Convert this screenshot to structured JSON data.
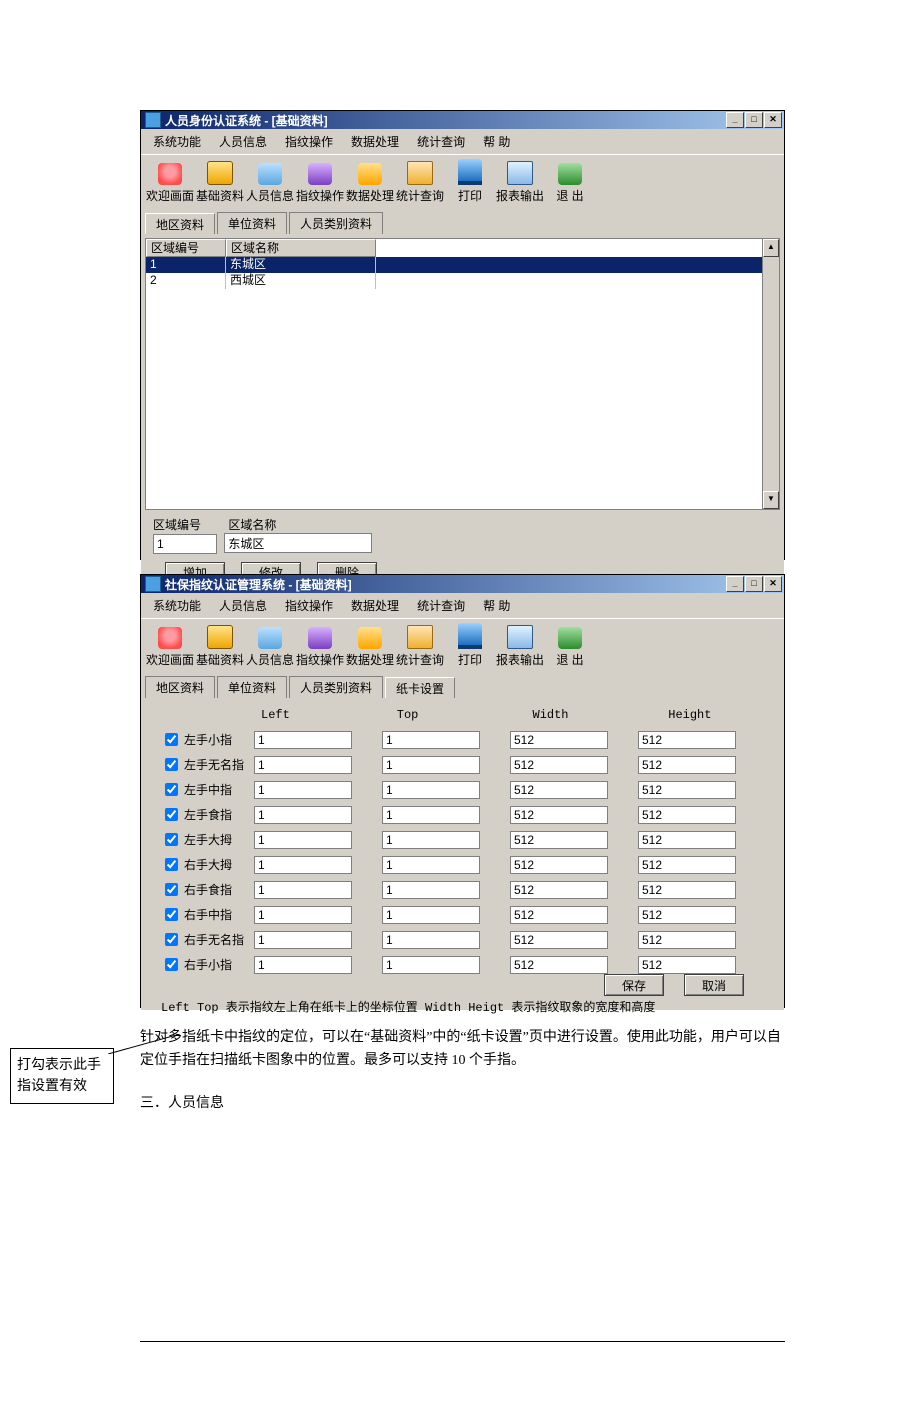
{
  "win1": {
    "title": "人员身份认证系统 - [基础资料]",
    "menu": [
      "系统功能",
      "人员信息",
      "指纹操作",
      "数据处理",
      "统计查询",
      "帮      助"
    ],
    "toolbar": [
      "欢迎画面",
      "基础资料",
      "人员信息",
      "指纹操作",
      "数据处理",
      "统计查询",
      "打印",
      "报表输出",
      "退  出"
    ],
    "tabs": [
      "地区资料",
      "单位资料",
      "人员类别资料"
    ],
    "grid": {
      "headers": [
        "区域编号",
        "区域名称"
      ],
      "rows": [
        {
          "id": "1",
          "name": "东城区"
        },
        {
          "id": "2",
          "name": "西城区"
        }
      ]
    },
    "edit": {
      "label_id": "区域编号",
      "label_name": "区域名称",
      "value_id": "1",
      "value_name": "东城区"
    },
    "buttons": {
      "add": "增加",
      "edit": "修改",
      "del": "删除"
    }
  },
  "win2": {
    "title": "社保指纹认证管理系统 - [基础资料]",
    "menu": [
      "系统功能",
      "人员信息",
      "指纹操作",
      "数据处理",
      "统计查询",
      "帮      助"
    ],
    "toolbar": [
      "欢迎画面",
      "基础资料",
      "人员信息",
      "指纹操作",
      "数据处理",
      "统计查询",
      "打印",
      "报表输出",
      "退  出"
    ],
    "tabs": [
      "地区资料",
      "单位资料",
      "人员类别资料",
      "纸卡设置"
    ],
    "colheads": [
      "Left",
      "Top",
      "Width",
      "Height"
    ],
    "fingers": [
      {
        "label": "左手小指",
        "left": "1",
        "top": "1",
        "width": "512",
        "height": "512"
      },
      {
        "label": "左手无名指",
        "left": "1",
        "top": "1",
        "width": "512",
        "height": "512"
      },
      {
        "label": "左手中指",
        "left": "1",
        "top": "1",
        "width": "512",
        "height": "512"
      },
      {
        "label": "左手食指",
        "left": "1",
        "top": "1",
        "width": "512",
        "height": "512"
      },
      {
        "label": "左手大拇",
        "left": "1",
        "top": "1",
        "width": "512",
        "height": "512"
      },
      {
        "label": "右手大拇",
        "left": "1",
        "top": "1",
        "width": "512",
        "height": "512"
      },
      {
        "label": "右手食指",
        "left": "1",
        "top": "1",
        "width": "512",
        "height": "512"
      },
      {
        "label": "右手中指",
        "left": "1",
        "top": "1",
        "width": "512",
        "height": "512"
      },
      {
        "label": "右手无名指",
        "left": "1",
        "top": "1",
        "width": "512",
        "height": "512"
      },
      {
        "label": "右手小指",
        "left": "1",
        "top": "1",
        "width": "512",
        "height": "512"
      }
    ],
    "help_note": "Left Top 表示指纹左上角在纸卡上的坐标位置 Width Heigt 表示指纹取象的宽度和高度",
    "buttons": {
      "save": "保存",
      "cancel": "取消"
    }
  },
  "callout": "打勾表示此手指设置有效",
  "body_paragraph": "针对多指纸卡中指纹的定位，可以在“基础资料”中的“纸卡设置”页中进行设置。使用此功能，用户可以自定位手指在扫描纸卡图象中的位置。最多可以支持 10 个手指。",
  "section_heading": "三．人员信息"
}
